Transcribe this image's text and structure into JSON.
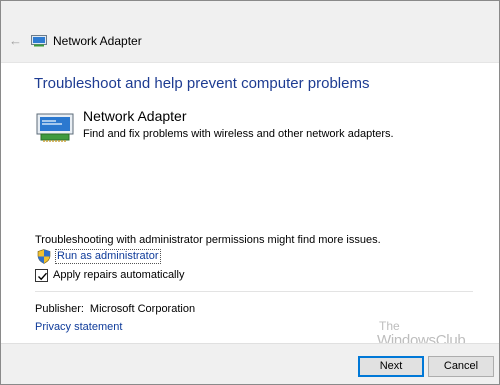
{
  "window": {
    "title": "Network Adapter",
    "back_icon": "back-arrow-icon"
  },
  "main": {
    "heading": "Troubleshoot and help prevent computer problems",
    "item": {
      "title": "Network Adapter",
      "description": "Find and fix problems with wireless and other network adapters.",
      "icon": "network-adapter-icon"
    },
    "admin_note": "Troubleshooting with administrator permissions might find more issues.",
    "admin_link": "Run as administrator",
    "checkbox": {
      "label": "Apply repairs automatically",
      "checked": true
    },
    "publisher_label": "Publisher:",
    "publisher_value": "Microsoft Corporation",
    "privacy_link": "Privacy statement"
  },
  "watermark": {
    "line1": "The",
    "line2": "WindowsClub"
  },
  "footer": {
    "next_label": "Next",
    "cancel_label": "Cancel"
  },
  "colors": {
    "heading": "#1e3c92",
    "link": "#0f3b9a",
    "accent": "#0078d7"
  }
}
